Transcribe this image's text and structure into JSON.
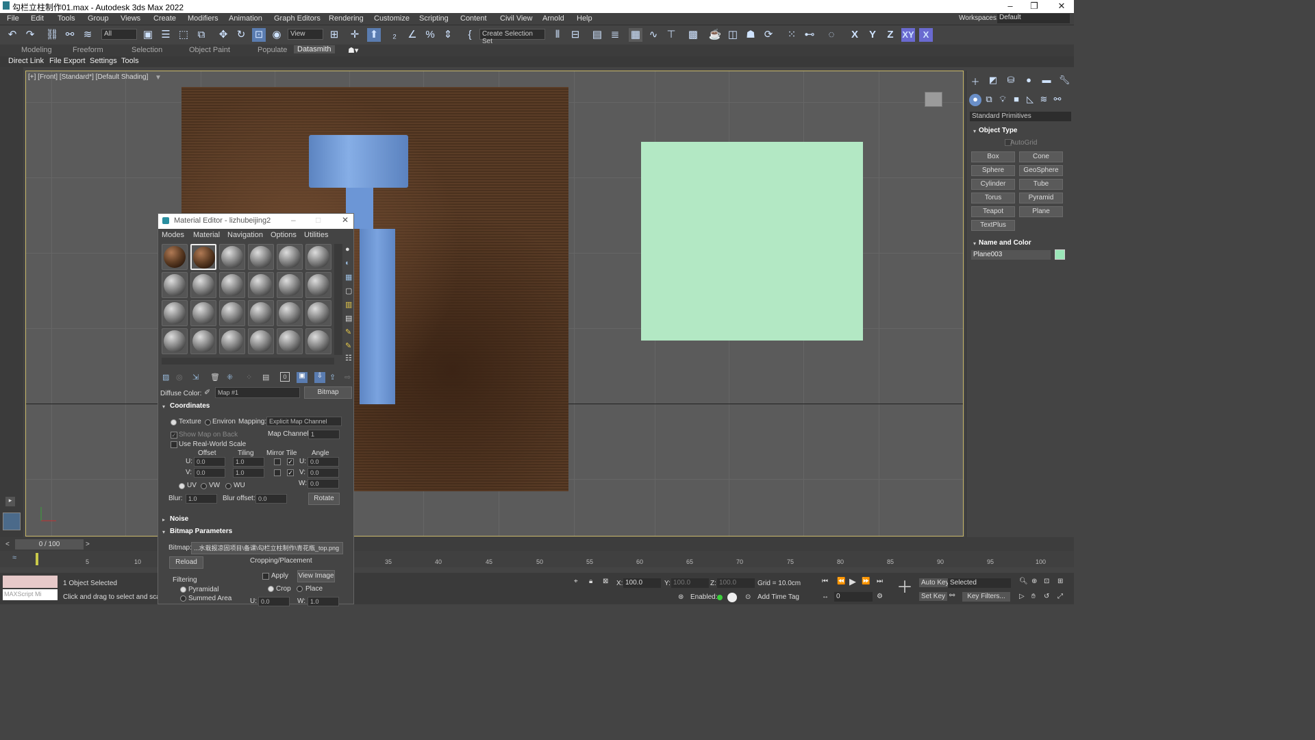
{
  "window": {
    "title": "勾栏立柱制作01.max - Autodesk 3ds Max 2022"
  },
  "menu": [
    "File",
    "Edit",
    "Tools",
    "Group",
    "Views",
    "Create",
    "Modifiers",
    "Animation",
    "Graph Editors",
    "Rendering",
    "Customize",
    "Scripting",
    "Content",
    "Civil View",
    "Arnold",
    "Help"
  ],
  "workspaces": {
    "label": "Workspaces:",
    "value": "Default"
  },
  "toolbar": {
    "filter_value": "All",
    "ref_coord_value": "View",
    "selection_set_value": "Create Selection Set",
    "axis_x": "X",
    "axis_y": "Y",
    "axis_z": "Z",
    "axis_xy": "XY",
    "axis_xz": "X"
  },
  "ribbon_tabs": [
    "Modeling",
    "Freeform",
    "Selection",
    "Object Paint",
    "Populate",
    "Datasmith"
  ],
  "datasmith": [
    "Direct Link",
    "File Export",
    "Settings",
    "Tools"
  ],
  "viewport": {
    "label": "[+] [Front] [Standard*] [Default Shading]"
  },
  "command_panel": {
    "category": "Standard Primitives",
    "object_type_title": "Object Type",
    "autogrid": "AutoGrid",
    "buttons": [
      "Box",
      "Cone",
      "Sphere",
      "GeoSphere",
      "Cylinder",
      "Tube",
      "Torus",
      "Pyramid",
      "Teapot",
      "Plane",
      "TextPlus"
    ],
    "name_color_title": "Name and Color",
    "object_name": "Plane003",
    "object_color": "#9be6b8"
  },
  "material_editor": {
    "title": "Material Editor - lizhubeijing2",
    "menu": [
      "Modes",
      "Material",
      "Navigation",
      "Options",
      "Utilities"
    ],
    "diffuse_label": "Diffuse Color:",
    "map_name": "Map #1",
    "map_type": "Bitmap",
    "coordinates": {
      "title": "Coordinates",
      "texture": "Texture",
      "environ": "Environ",
      "mapping_label": "Mapping:",
      "mapping_value": "Explicit Map Channel",
      "show_map_on_back": "Show Map on Back",
      "map_channel_label": "Map Channel:",
      "map_channel_value": "1",
      "real_world": "Use Real-World Scale",
      "offset": "Offset",
      "tiling": "Tiling",
      "mirror_tile": "Mirror Tile",
      "angle": "Angle",
      "u_label": "U:",
      "v_label": "V:",
      "w_label": "W:",
      "u_offset": "0.0",
      "v_offset": "0.0",
      "u_tiling": "1.0",
      "v_tiling": "1.0",
      "u_angle": "0.0",
      "v_angle": "0.0",
      "w_angle": "0.0",
      "uv": "UV",
      "vw": "VW",
      "wu": "WU",
      "blur_label": "Blur:",
      "blur_value": "1.0",
      "blur_offset_label": "Blur offset:",
      "blur_offset_value": "0.0",
      "rotate": "Rotate"
    },
    "noise_title": "Noise",
    "bitmap_params": {
      "title": "Bitmap Parameters",
      "bitmap_label": "Bitmap:",
      "bitmap_path": "...水栽报凉固项目\\备课\\勾栏立柱制作\\青花瓶_top.png",
      "reload": "Reload",
      "cropping_title": "Cropping/Placement",
      "apply": "Apply",
      "view_image": "View Image",
      "crop": "Crop",
      "place": "Place",
      "filtering_title": "Filtering",
      "pyramidal": "Pyramidal",
      "summed_area": "Summed Area",
      "u_label": "U:",
      "u_value": "0.0",
      "w_label": "W:",
      "w_value": "1.0"
    }
  },
  "timeline": {
    "frame_display": "0 / 100",
    "ticks": [
      "5",
      "10",
      "35",
      "40",
      "45",
      "50",
      "55",
      "60",
      "65",
      "70",
      "75",
      "80",
      "85",
      "90",
      "95",
      "100"
    ]
  },
  "status": {
    "selected": "1 Object Selected",
    "prompt": "Click and drag to select and scale ol",
    "maxscript": "MAXScript Mi",
    "x_label": "X:",
    "x_value": "100.0",
    "y_label": "Y:",
    "y_value": "100.0",
    "z_label": "Z:",
    "z_value": "100.0",
    "grid": "Grid = 10.0cm",
    "enabled": "Enabled:",
    "add_time_tag": "Add Time Tag",
    "auto_key": "Auto Key",
    "set_key": "Set Key",
    "key_mode": "Selected",
    "key_filters": "Key Filters...",
    "frame_value": "0"
  }
}
